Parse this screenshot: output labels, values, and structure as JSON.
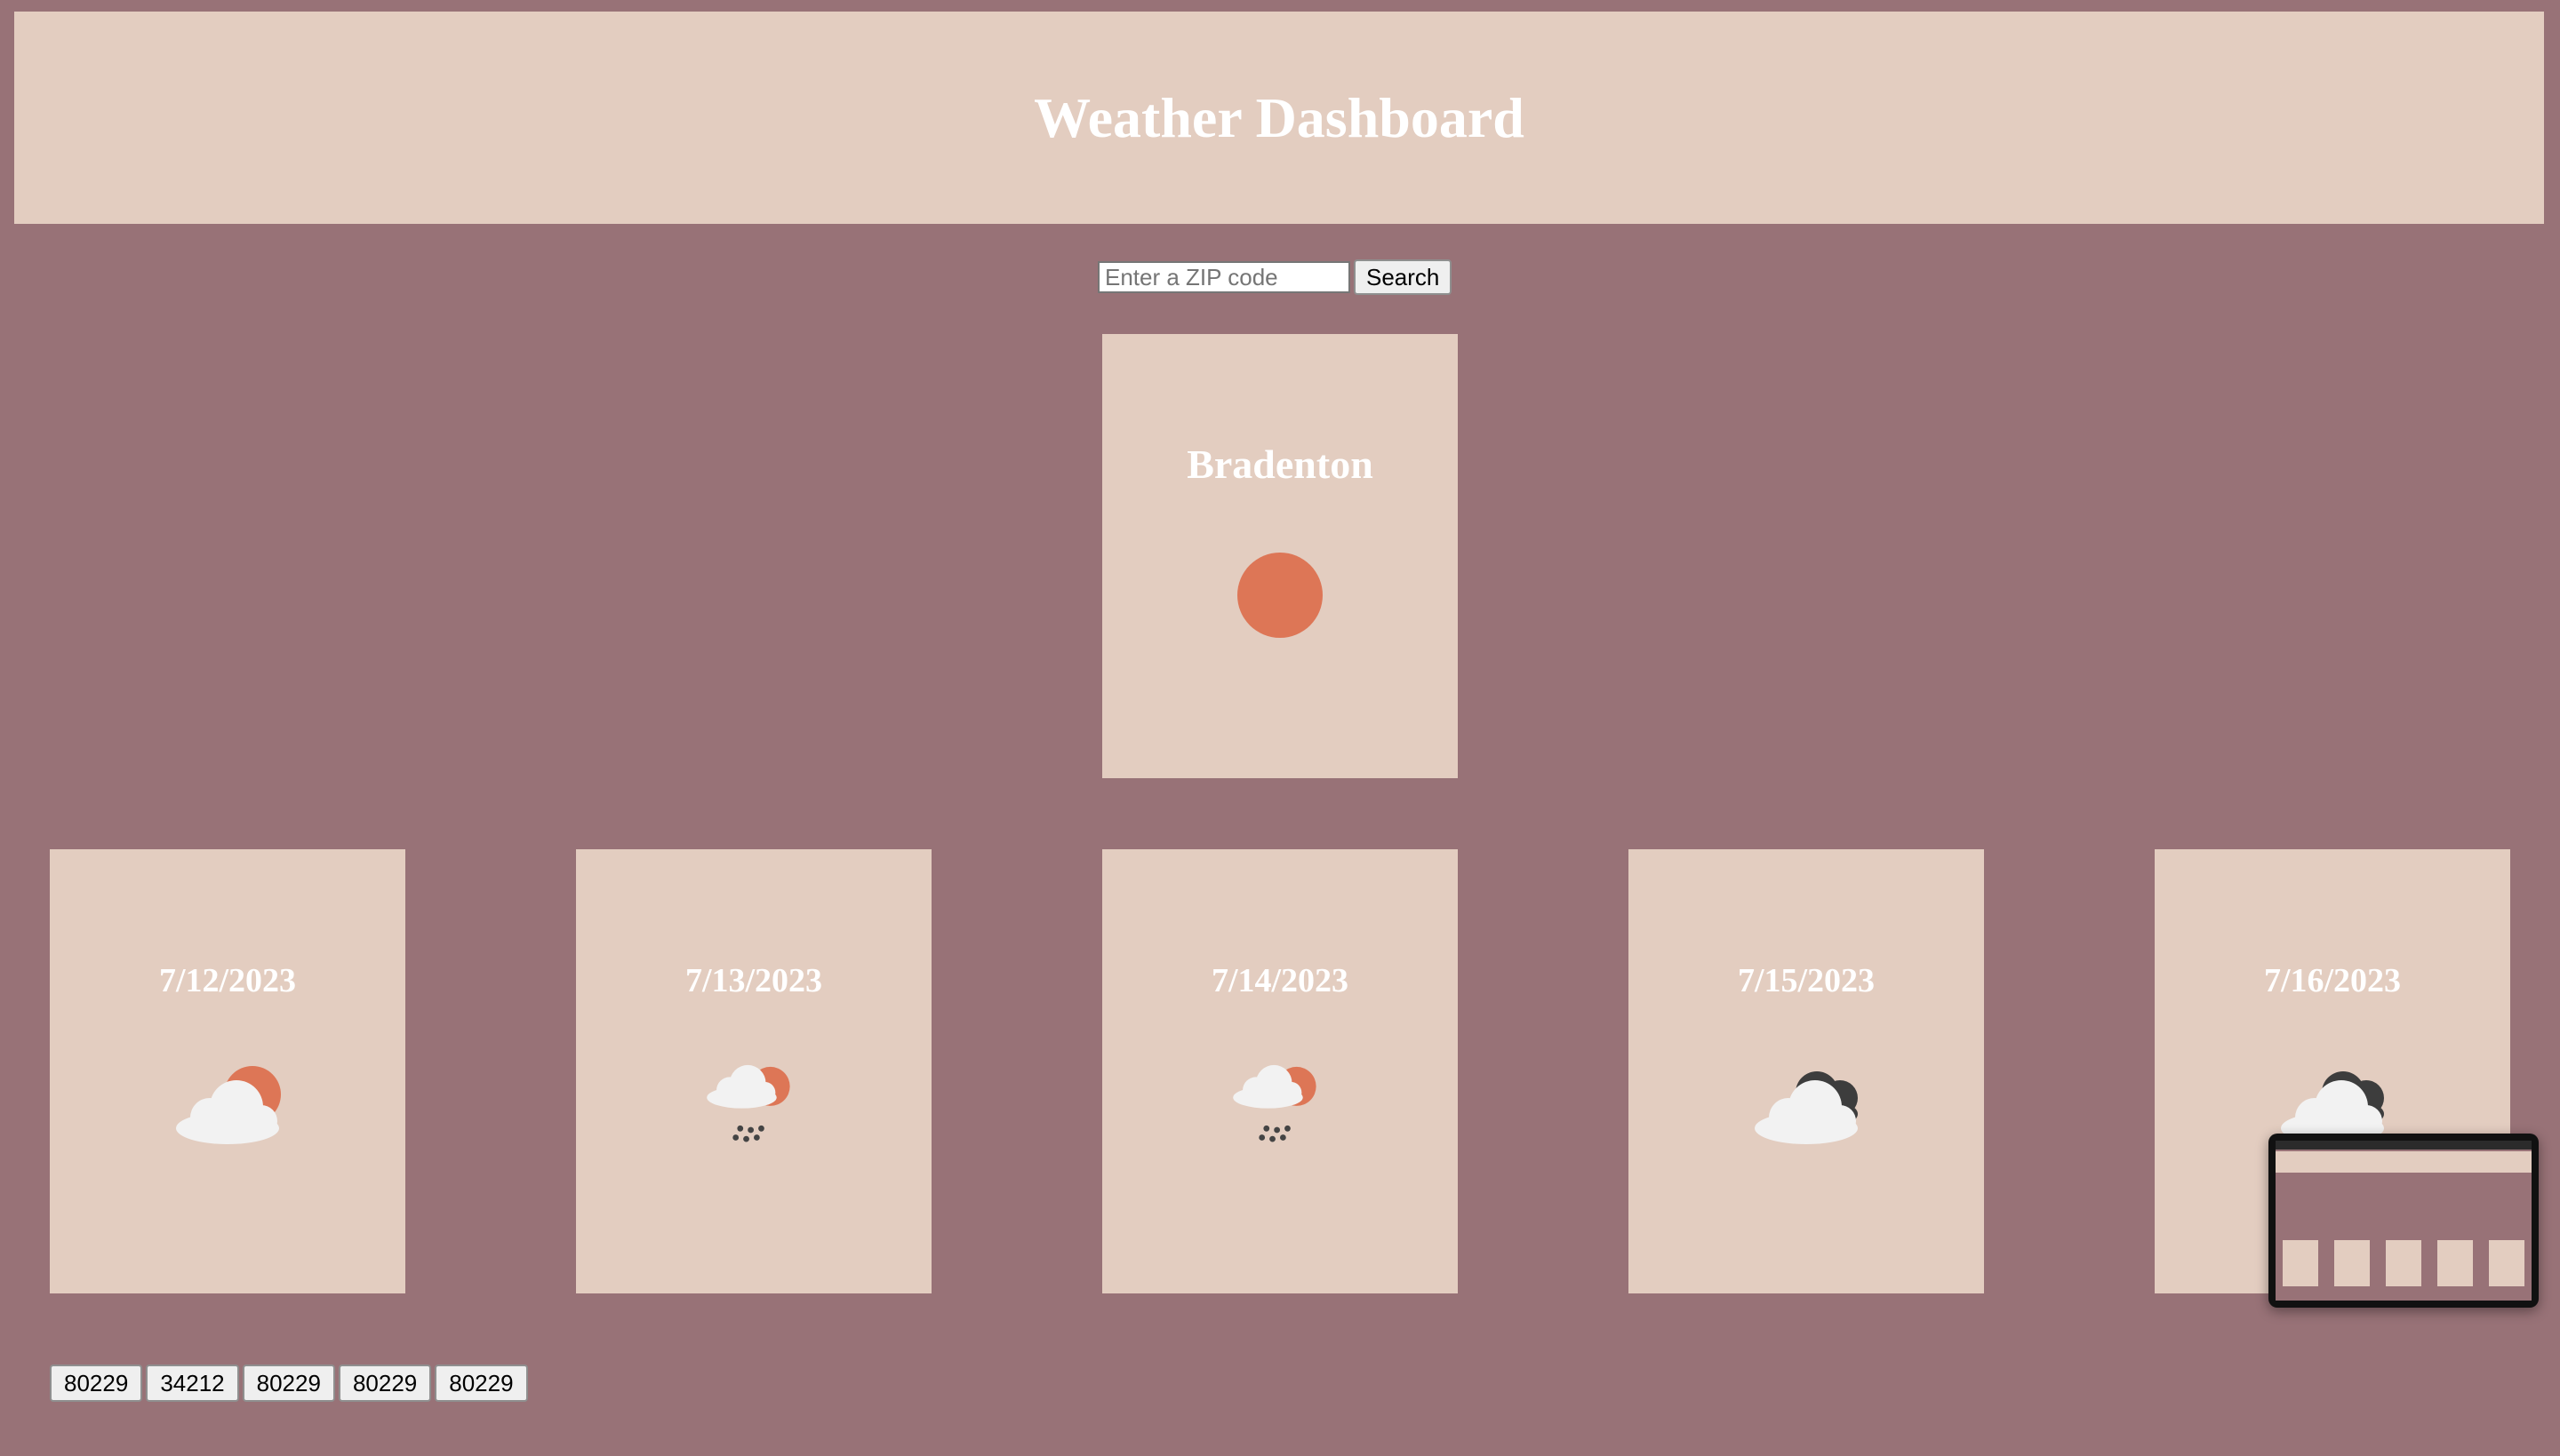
{
  "header": {
    "title": "Weather Dashboard"
  },
  "search": {
    "placeholder": "Enter a ZIP code",
    "button_label": "Search"
  },
  "current": {
    "city": "Bradenton",
    "icon": "sun-icon"
  },
  "forecast": [
    {
      "date": "7/12/2023",
      "icon": "partly-cloudy-sun-icon"
    },
    {
      "date": "7/13/2023",
      "icon": "rain-sun-icon"
    },
    {
      "date": "7/14/2023",
      "icon": "rain-sun-icon"
    },
    {
      "date": "7/15/2023",
      "icon": "cloudy-icon"
    },
    {
      "date": "7/16/2023",
      "icon": "cloudy-icon"
    }
  ],
  "history": [
    "80229",
    "34212",
    "80229",
    "80229",
    "80229"
  ],
  "colors": {
    "background": "#987277",
    "card": "#e3cdc0",
    "sun": "#dd7656",
    "cloud": "#f2f2f2",
    "dark_cloud": "#3d3d3d"
  }
}
